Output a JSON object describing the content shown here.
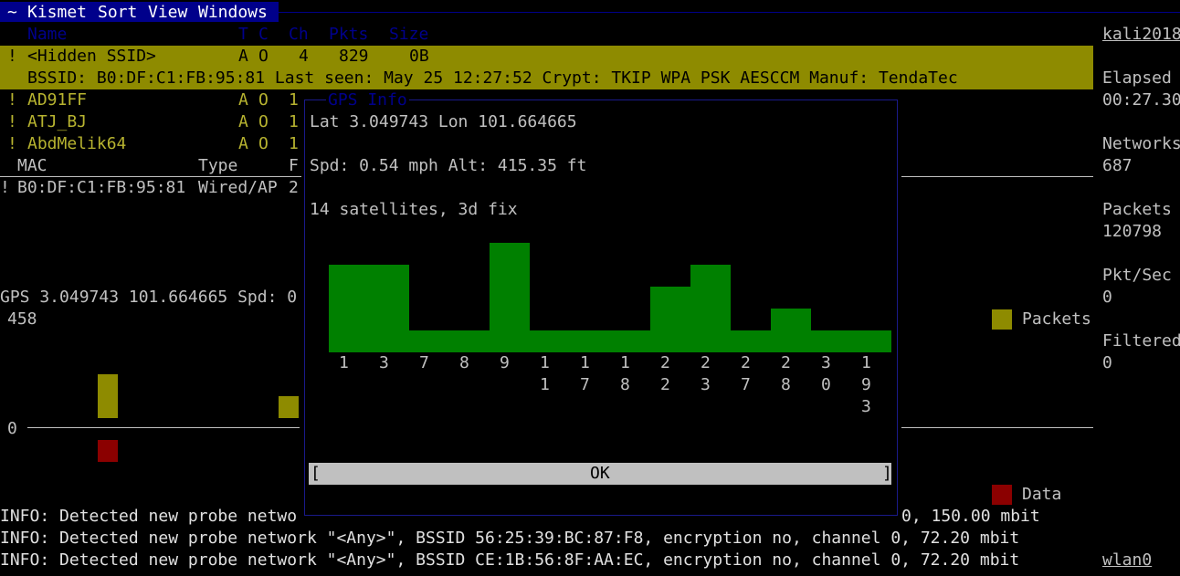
{
  "menu": {
    "tilde": "~",
    "items": [
      "Kismet",
      "Sort",
      "View",
      "Windows"
    ]
  },
  "network_list": {
    "headers": [
      "Name",
      "T",
      "C",
      "Ch",
      "Pkts",
      "Size"
    ],
    "selected": {
      "flag": "!",
      "name": "<Hidden SSID>",
      "t": "A",
      "c": "O",
      "ch": "4",
      "pkts": "829",
      "size": "0B",
      "detail": "BSSID: B0:DF:C1:FB:95:81 Last seen: May 25 12:27:52 Crypt: TKIP WPA PSK AESCCM Manuf: TendaTec"
    },
    "rows": [
      {
        "flag": "!",
        "name": "AD91FF",
        "t": "A",
        "c": "O",
        "ch": "1"
      },
      {
        "flag": "!",
        "name": "ATJ_BJ",
        "t": "A",
        "c": "O",
        "ch": "1"
      },
      {
        "flag": "!",
        "name": "AbdMelik64",
        "t": "A",
        "c": "O",
        "ch": "1"
      }
    ]
  },
  "client_list": {
    "headers": [
      "MAC",
      "Type",
      "F"
    ],
    "rows": [
      {
        "flag": "!",
        "mac": "B0:DF:C1:FB:95:81",
        "type": "Wired/AP",
        "f": "2"
      }
    ]
  },
  "gps_line": "GPS 3.049743 101.664665 Spd: 0",
  "graph": {
    "top_value": "458",
    "zero_label": "0",
    "legend_packets": "Packets",
    "legend_data": "Data",
    "packets_color": "#8e8b00",
    "data_color": "#8b0000"
  },
  "gps_dialog": {
    "title": "GPS Info",
    "lat_lon": "Lat 3.049743 Lon 101.664665",
    "speed_alt": "Spd: 0.54 mph Alt: 415.35 ft",
    "satellites": "14 satellites, 3d fix",
    "ok_label": "OK",
    "bracket_left": "[",
    "bracket_right": "]",
    "bar_color": "#008000",
    "bars": [
      {
        "label": [
          "1"
        ],
        "level": 4
      },
      {
        "label": [
          "3"
        ],
        "level": 4
      },
      {
        "label": [
          "7"
        ],
        "level": 1
      },
      {
        "label": [
          "8"
        ],
        "level": 1
      },
      {
        "label": [
          "9"
        ],
        "level": 5
      },
      {
        "label": [
          "1",
          "1"
        ],
        "level": 1
      },
      {
        "label": [
          "1",
          "7"
        ],
        "level": 1
      },
      {
        "label": [
          "1",
          "8"
        ],
        "level": 1
      },
      {
        "label": [
          "2",
          "2"
        ],
        "level": 3
      },
      {
        "label": [
          "2",
          "3"
        ],
        "level": 4
      },
      {
        "label": [
          "2",
          "7"
        ],
        "level": 1
      },
      {
        "label": [
          "2",
          "8"
        ],
        "level": 2
      },
      {
        "label": [
          "3",
          "0"
        ],
        "level": 1
      },
      {
        "label": [
          "1",
          "9",
          "3"
        ],
        "level": 1
      }
    ]
  },
  "sidebar": {
    "host": "kali2018",
    "items": [
      {
        "label": "Elapsed",
        "value": "00:27.30"
      },
      {
        "label": "Networks",
        "value": "687"
      },
      {
        "label": "Packets",
        "value": "120798"
      },
      {
        "label": "Pkt/Sec",
        "value": "0"
      },
      {
        "label": "Filtered",
        "value": "0"
      }
    ],
    "interface": "wlan0"
  },
  "log": {
    "partial_prefix": "INFO: Detected new probe netwo",
    "partial_suffix": "0, 150.00 mbit",
    "lines": [
      "INFO: Detected new probe network \"<Any>\", BSSID 56:25:39:BC:87:F8, encryption no, channel 0, 72.20 mbit",
      "INFO: Detected new probe network \"<Any>\", BSSID CE:1B:56:8F:AA:EC, encryption no, channel 0, 72.20 mbit"
    ]
  }
}
